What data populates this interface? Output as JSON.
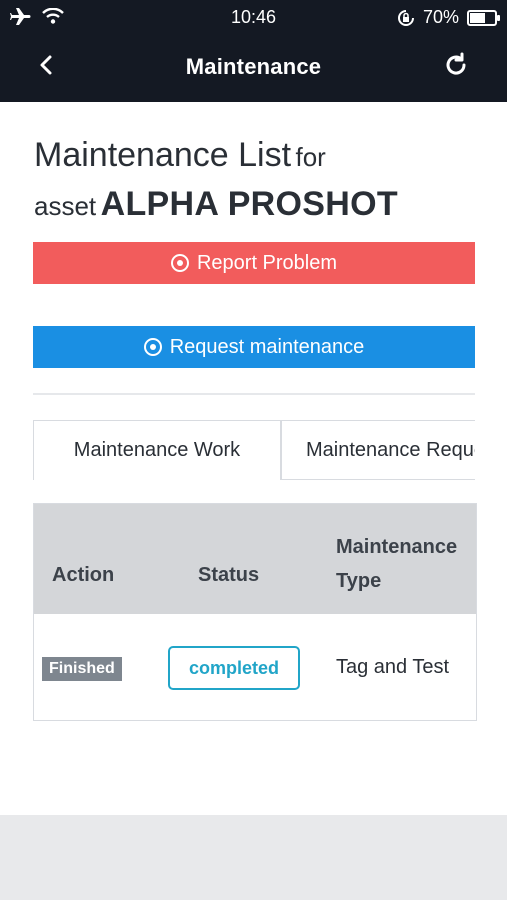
{
  "status_bar": {
    "time": "10:46",
    "battery": "70%",
    "battery_level": 0.7,
    "icons": [
      "airplane-icon",
      "wifi-icon",
      "orientation-lock-icon",
      "battery-icon"
    ]
  },
  "nav": {
    "title": "Maintenance",
    "back_icon": "chevron-left-icon",
    "refresh_icon": "refresh-icon"
  },
  "heading": {
    "title": "Maintenance List",
    "for_text": "for",
    "asset_prefix": "asset",
    "asset_name": "ALPHA PROSHOT"
  },
  "buttons": {
    "report": "Report Problem",
    "request": "Request maintenance"
  },
  "tabs": [
    {
      "label": "Maintenance Work",
      "active": true
    },
    {
      "label": "Maintenance Requests",
      "active": false
    }
  ],
  "table": {
    "headers": {
      "action": "Action",
      "status": "Status",
      "type_line1": "Maintenance",
      "type_line2": "Type"
    },
    "rows": [
      {
        "action": "Finished",
        "status": "completed",
        "type": "Tag and Test"
      }
    ]
  },
  "colors": {
    "header_bg": "#141923",
    "report_button": "#f25c5c",
    "request_button": "#1a8fe3",
    "completed_badge": "#21a5c8",
    "finished_badge": "#7e868f"
  }
}
